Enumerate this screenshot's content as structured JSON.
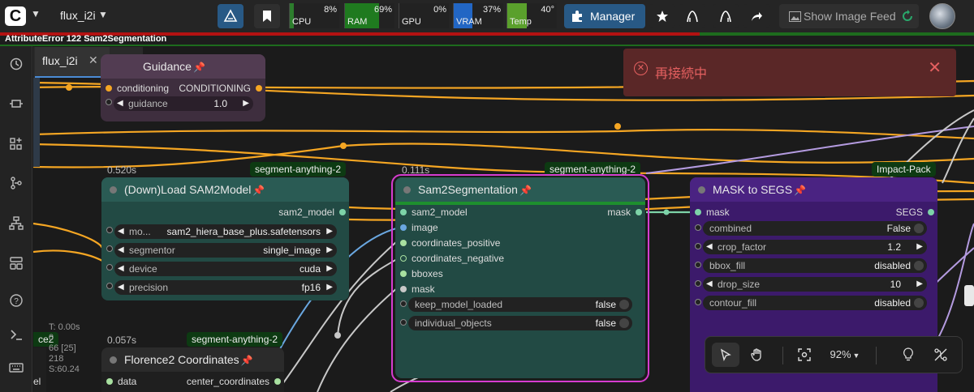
{
  "topbar": {
    "workflow_name": "flux_i2i",
    "meters": [
      {
        "label": "CPU",
        "value": "8%",
        "fill": 0.08,
        "color": "#2d7d2d"
      },
      {
        "label": "RAM",
        "value": "69%",
        "fill": 0.69,
        "color": "#1f7a1f"
      },
      {
        "label": "GPU",
        "value": "0%",
        "fill": 0.0,
        "color": "#2d7d2d"
      },
      {
        "label": "VRAM",
        "value": "37%",
        "fill": 0.37,
        "color": "#2266c4"
      },
      {
        "label": "Temp",
        "value": "40°",
        "fill": 0.4,
        "color": "#5aa02c"
      }
    ],
    "manager_label": "Manager",
    "image_feed_label": "Show Image Feed"
  },
  "error": {
    "message": "AttributeError 122 Sam2Segmentation"
  },
  "tabs": [
    {
      "label": "flux_i2i"
    }
  ],
  "toast": {
    "message": "再接続中"
  },
  "nodes": {
    "guidance": {
      "title": "Guidance",
      "inputs": [
        "conditioning"
      ],
      "outputs": [
        "CONDITIONING"
      ],
      "widgets": [
        {
          "label": "guidance",
          "value": "1.0"
        }
      ]
    },
    "sam2_loader": {
      "title": "(Down)Load SAM2Model",
      "timing": "0.520s",
      "badge": "segment-anything-2",
      "outputs": [
        "sam2_model"
      ],
      "widgets": [
        {
          "label": "mo...",
          "value": "sam2_hiera_base_plus.safetensors"
        },
        {
          "label": "segmentor",
          "value": "single_image"
        },
        {
          "label": "device",
          "value": "cuda"
        },
        {
          "label": "precision",
          "value": "fp16"
        }
      ]
    },
    "sam2_seg": {
      "title": "Sam2Segmentation",
      "timing": "0.111s",
      "badge": "segment-anything-2",
      "inputs": [
        "sam2_model",
        "image",
        "coordinates_positive",
        "coordinates_negative",
        "bboxes",
        "mask"
      ],
      "outputs": [
        "mask"
      ],
      "widgets": [
        {
          "label": "keep_model_loaded",
          "value": "false"
        },
        {
          "label": "individual_objects",
          "value": "false"
        }
      ]
    },
    "mask_to_segs": {
      "title": "MASK to SEGS",
      "badge": "Impact-Pack",
      "inputs": [
        "mask"
      ],
      "outputs": [
        "SEGS"
      ],
      "widgets": [
        {
          "label": "combined",
          "value": "False"
        },
        {
          "label": "crop_factor",
          "value": "1.2"
        },
        {
          "label": "bbox_fill",
          "value": "disabled"
        },
        {
          "label": "drop_size",
          "value": "10"
        },
        {
          "label": "contour_fill",
          "value": "disabled"
        }
      ]
    },
    "florence": {
      "title": "Florence2 Coordinates",
      "timing": "0.057s",
      "badge": "segment-anything-2",
      "inputs": [
        "data"
      ],
      "outputs": [
        "center_coordinates"
      ]
    },
    "partial_left": {
      "badge": "ce2",
      "slot": "el"
    }
  },
  "log_overlay": [
    "T: 0.00s",
    "0",
    "66 [25]",
    "218",
    "S:60.24"
  ],
  "bottom_toolbar": {
    "zoom": "92%"
  }
}
